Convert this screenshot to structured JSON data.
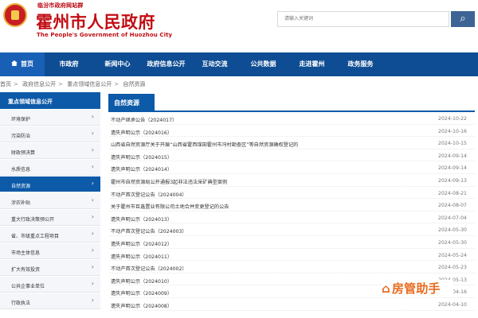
{
  "header": {
    "site_group": "临汾市政府网站群",
    "title": "霍州市人民政府",
    "subtitle": "The People's Government of Huozhou City",
    "search": {
      "placeholder": "请输入关键词"
    }
  },
  "nav": [
    {
      "label": "首页"
    },
    {
      "label": "市政府"
    },
    {
      "label": "新闻中心"
    },
    {
      "label": "政府信息公开"
    },
    {
      "label": "互动交流"
    },
    {
      "label": "公共数据"
    },
    {
      "label": "走进霍州"
    },
    {
      "label": "政务服务"
    }
  ],
  "breadcrumb": [
    "首页",
    "政府信息公开",
    "重点领域信息公开",
    "自然资源"
  ],
  "sidebar": {
    "header": "重点领域信息公开",
    "items": [
      {
        "label": "环境保护"
      },
      {
        "label": "污染防治"
      },
      {
        "label": "财政预决算"
      },
      {
        "label": "水质信息"
      },
      {
        "label": "自然资源",
        "active": true
      },
      {
        "label": "涉农补贴"
      },
      {
        "label": "重大行政决策预公开"
      },
      {
        "label": "省、市级重点工程项目"
      },
      {
        "label": "市场主体信息"
      },
      {
        "label": "扩大有效投资"
      },
      {
        "label": "公共企事业单位"
      },
      {
        "label": "行政执法"
      }
    ]
  },
  "content": {
    "section_title": "自然资源",
    "rows": [
      {
        "title": "不动产继承公告（2024017）",
        "date": "2024-10-22"
      },
      {
        "title": "遗失声明公示（2024016）",
        "date": "2024-10-16"
      },
      {
        "title": "山西省自然资源厅关于开展“山西省霍西煤田霍州市冯村勘查区”等自然资源确权登记的",
        "date": "2024-10-15"
      },
      {
        "title": "遗失声明公示（2024015）",
        "date": "2024-09-14"
      },
      {
        "title": "遗失声明公示（2024014）",
        "date": "2024-09-14"
      },
      {
        "title": "霍州市自然资源局公开通报3起非法违法采矿典型案例",
        "date": "2024-09-13"
      },
      {
        "title": "不动产首次登记公告（2024004）",
        "date": "2024-08-21"
      },
      {
        "title": "关于霍州市巨鑫置业有限公司土地合并变更登记的公告",
        "date": "2024-08-07"
      },
      {
        "title": "遗失声明公示（2024013）",
        "date": "2024-07-04"
      },
      {
        "title": "不动产首次登记公告（2024003）",
        "date": "2024-05-30"
      },
      {
        "title": "遗失声明公示（2024012）",
        "date": "2024-05-30"
      },
      {
        "title": "遗失声明公示（2024011）",
        "date": "2024-05-24"
      },
      {
        "title": "不动产首次登记公告（2024002）",
        "date": "2024-05-23"
      },
      {
        "title": "遗失声明公示（2024010）",
        "date": "2024-05-13"
      },
      {
        "title": "遗失声明公示（2024009）",
        "date": "2024-04-16"
      },
      {
        "title": "遗失声明公示（2024008）",
        "date": "2024-04-10"
      }
    ]
  },
  "watermark": {
    "text": "房管助手",
    "icon": "house-icon"
  }
}
